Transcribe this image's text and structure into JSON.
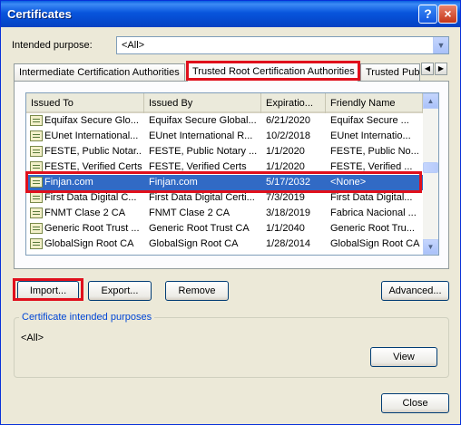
{
  "window": {
    "title": "Certificates",
    "help_button": "?",
    "close_button": "×"
  },
  "purpose": {
    "label": "Intended purpose:",
    "value": "<All>",
    "arrow": "▼"
  },
  "tabs": [
    {
      "label": "Intermediate Certification Authorities"
    },
    {
      "label": "Trusted Root Certification Authorities"
    },
    {
      "label": "Trusted Publ"
    }
  ],
  "tab_nav": {
    "prev": "◀",
    "next": "▶"
  },
  "list": {
    "headers": [
      "Issued To",
      "Issued By",
      "Expiratio...",
      "Friendly Name"
    ],
    "rows": [
      [
        "Equifax Secure Glo...",
        "Equifax Secure Global...",
        "6/21/2020",
        "Equifax Secure ..."
      ],
      [
        "EUnet International...",
        "EUnet International R...",
        "10/2/2018",
        "EUnet Internatio..."
      ],
      [
        "FESTE, Public Notar...",
        "FESTE, Public Notary ...",
        "1/1/2020",
        "FESTE, Public No..."
      ],
      [
        "FESTE, Verified Certs",
        "FESTE, Verified Certs",
        "1/1/2020",
        "FESTE, Verified ..."
      ],
      [
        "Finjan.com",
        "Finjan.com",
        "5/17/2032",
        "<None>"
      ],
      [
        "First Data Digital C...",
        "First Data Digital Certi...",
        "7/3/2019",
        "First Data Digital..."
      ],
      [
        "FNMT Clase 2 CA",
        "FNMT Clase 2 CA",
        "3/18/2019",
        "Fabrica Nacional ..."
      ],
      [
        "Generic Root Trust ...",
        "Generic Root Trust CA",
        "1/1/2040",
        "Generic Root Tru..."
      ],
      [
        "GlobalSign Root CA",
        "GlobalSign Root CA",
        "1/28/2014",
        "GlobalSign Root CA"
      ]
    ],
    "selected_row": 4,
    "scroll_up": "▲",
    "scroll_down": "▼"
  },
  "actions": {
    "import": "Import...",
    "export": "Export...",
    "remove": "Remove",
    "advanced": "Advanced..."
  },
  "purposes_group": {
    "label": "Certificate intended purposes",
    "value": "<All>",
    "view_button": "View"
  },
  "close_button": "Close",
  "colors": {
    "selection": "#316ac5",
    "highlight_box": "#e0101c",
    "titlebar": "#0855dd"
  }
}
